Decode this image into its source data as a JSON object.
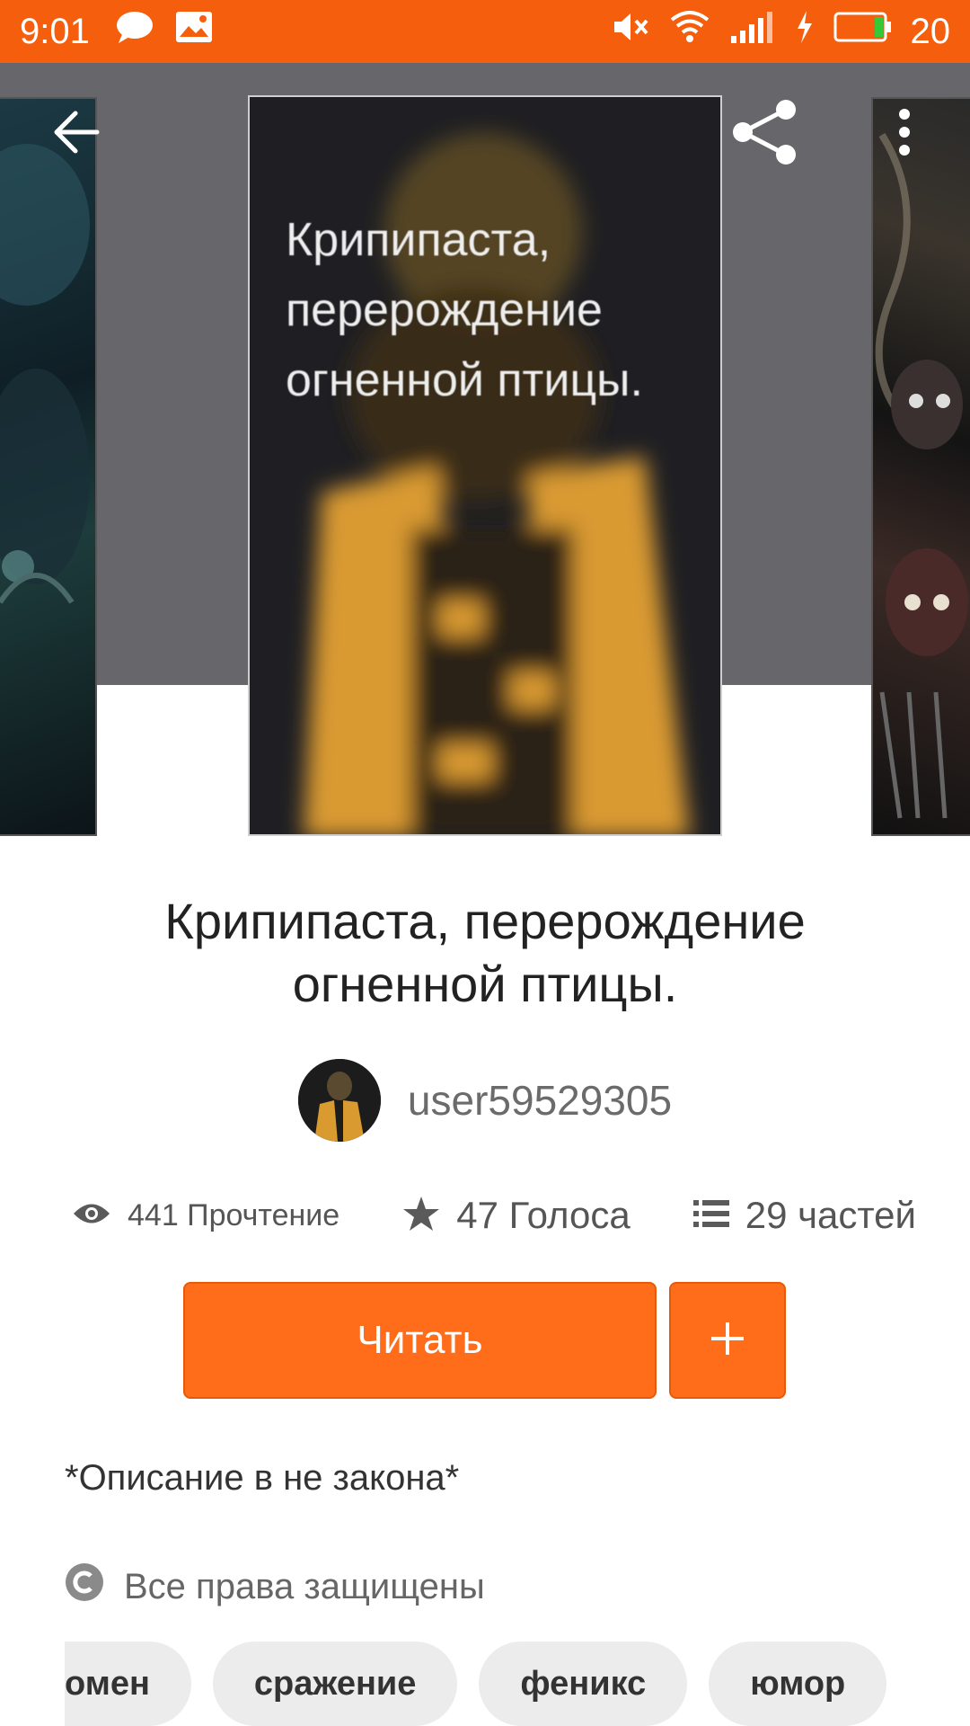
{
  "status_bar": {
    "time": "9:01",
    "battery_level": "20",
    "icons": [
      "chat-bubble-icon",
      "image-icon",
      "mute-icon",
      "wifi-icon",
      "signal-icon",
      "charging-icon",
      "battery-icon"
    ]
  },
  "header": {
    "icons": [
      "back-arrow-icon",
      "share-icon",
      "more-vertical-icon"
    ]
  },
  "cover": {
    "text": "Крипипаста, перерождение огненной птицы."
  },
  "story": {
    "title": "Крипипаста, перерождение огненной птицы.",
    "author": "user59529305"
  },
  "stats": {
    "reads": "441 Прочтение",
    "votes": "47 Голоса",
    "parts": "29 частей"
  },
  "actions": {
    "read_label": "Читать"
  },
  "description": "*Описание в не закона*",
  "rights": "Все права защищены",
  "tags": [
    "омен",
    "сражение",
    "феникс",
    "юмор"
  ],
  "colors": {
    "accent": "#ff6d1b",
    "status_bar": "#f45e0d",
    "hero_bg": "#67676b",
    "cover_yellow": "#e0a030"
  }
}
